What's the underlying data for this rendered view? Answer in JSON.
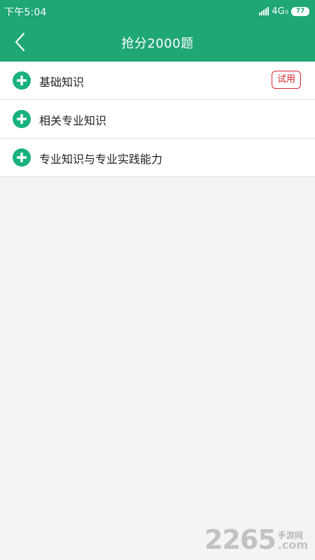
{
  "status_bar": {
    "time": "下午5:04",
    "network": "4G",
    "network_sub": "ll",
    "battery": "77"
  },
  "header": {
    "title": "抢分2000题"
  },
  "list": {
    "items": [
      {
        "label": "基础知识",
        "badge": "试用"
      },
      {
        "label": "相关专业知识",
        "badge": ""
      },
      {
        "label": "专业知识与专业实践能力",
        "badge": ""
      }
    ]
  },
  "watermark": {
    "number": "2265",
    "cn": "手游网",
    "com": ".com"
  },
  "colors": {
    "primary": "#1fa776",
    "badge_red": "#d9262c",
    "background": "#f4f4f4",
    "icon_green": "#19b27c"
  }
}
